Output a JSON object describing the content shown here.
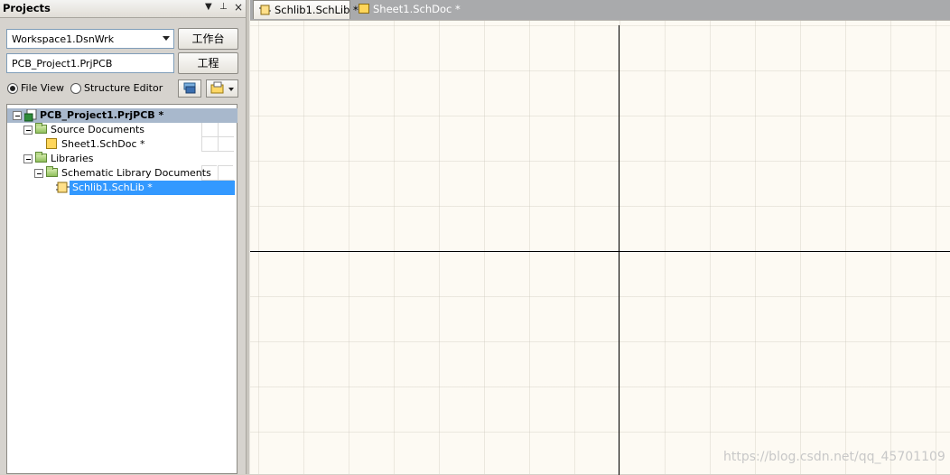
{
  "panel": {
    "title": "Projects",
    "header_buttons": [
      "▼",
      "⊥",
      "×"
    ],
    "workspace_value": "Workspace1.DsnWrk",
    "workspace_button": "工作台",
    "project_value": "PCB_Project1.PrjPCB",
    "project_button": "工程",
    "view_options": [
      {
        "label": "File View",
        "selected": true
      },
      {
        "label": "Structure Editor",
        "selected": false
      }
    ]
  },
  "tree": {
    "project": "PCB_Project1.PrjPCB *",
    "source_group": "Source Documents",
    "sheet": "Sheet1.SchDoc *",
    "libraries_group": "Libraries",
    "schlib_group": "Schematic Library Documents",
    "schlib": "Schlib1.SchLib *",
    "selected_color": "#3399ff",
    "project_row_color": "#a8b8cc"
  },
  "tabs": [
    {
      "label": "Schlib1.SchLib *",
      "active": true
    },
    {
      "label": "Sheet1.SchDoc *",
      "active": false
    }
  ],
  "canvas": {
    "background": "#fdfaf3",
    "watermark": "https://blog.csdn.net/qq_45701109"
  }
}
